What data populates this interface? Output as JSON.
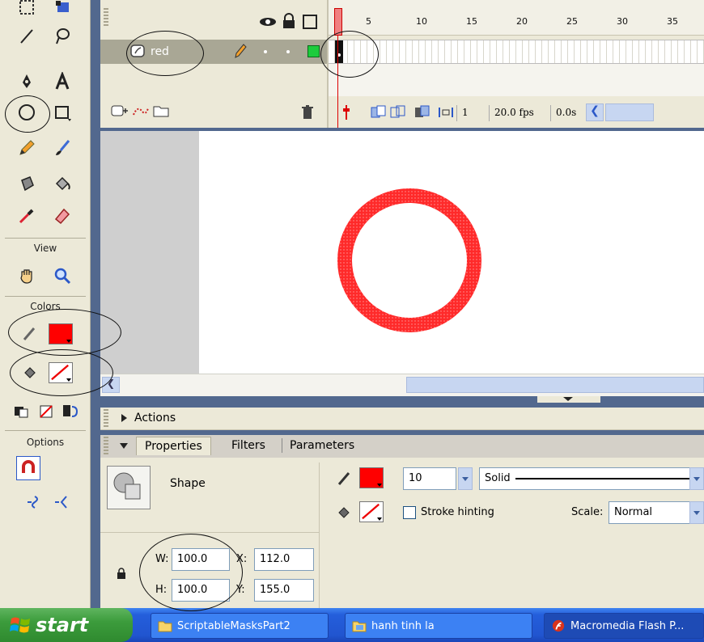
{
  "toolbar": {
    "view_label": "View",
    "colors_label": "Colors",
    "options_label": "Options",
    "stroke_color": "#ff0000",
    "fill_color": "none"
  },
  "timeline": {
    "layer_name": "red",
    "frame_numbers": [
      "1",
      "5",
      "10",
      "15",
      "20",
      "25",
      "30",
      "35"
    ],
    "current_frame": "1",
    "frame_rate": "20.0 fps",
    "elapsed_time": "0.0s"
  },
  "stage": {
    "shape_color": "#ff2a2a"
  },
  "panel": {
    "actions_label": "Actions",
    "tabs": [
      "Properties",
      "Filters",
      "Parameters"
    ],
    "object_type": "Shape",
    "stroke_height": "10",
    "stroke_style": "Solid",
    "stroke_hinting_label": "Stroke hinting",
    "scale_label": "Scale:",
    "scale_value": "Normal",
    "w_label": "W:",
    "h_label": "H:",
    "x_label": "X:",
    "y_label": "Y:",
    "w_value": "100.0",
    "h_value": "100.0",
    "x_value": "112.0",
    "y_value": "155.0"
  },
  "taskbar": {
    "start_label": "start",
    "items": [
      "ScriptableMasksPart2",
      "hanh tinh la",
      "Macromedia Flash P..."
    ]
  }
}
